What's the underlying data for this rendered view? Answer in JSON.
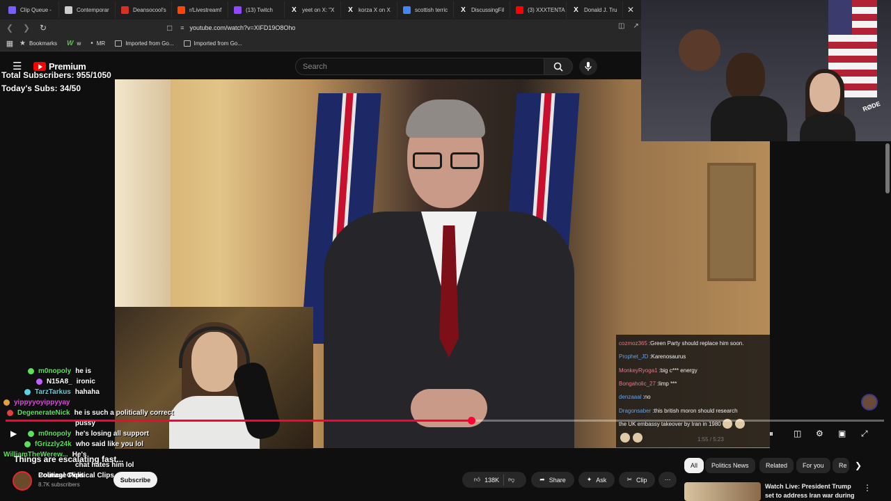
{
  "browser": {
    "tabs": [
      {
        "label": "Clip Queue -",
        "icon_color": "#7b5cff"
      },
      {
        "label": "Contemporar",
        "icon_color": "#cccccc"
      },
      {
        "label": "Deansocool's",
        "icon_color": "#d93025"
      },
      {
        "label": "r/Livestreamf",
        "icon_color": "#ff4500"
      },
      {
        "label": "(13) Twitch",
        "icon_color": "#9146ff"
      },
      {
        "label": "yeet on X: \"X",
        "icon": "x-logo"
      },
      {
        "label": "korza X on X",
        "icon": "x-logo"
      },
      {
        "label": "scottish terric",
        "icon_color": "#4285f4"
      },
      {
        "label": "DiscussingFil",
        "icon": "x-logo"
      },
      {
        "label": "(3) XXXTENTA",
        "icon_color": "#ff0000"
      },
      {
        "label": "Donald J. Tru",
        "icon": "x-logo"
      }
    ],
    "url": "youtube.com/watch?v=XIFD19O8Oho",
    "bookmarks": [
      {
        "label": "Bookmarks",
        "icon": "star-icon"
      },
      {
        "label": "w",
        "icon": "w-logo"
      },
      {
        "label": "MR",
        "icon": "dot-icon"
      },
      {
        "label": "Imported from Go...",
        "icon": "folder-icon"
      },
      {
        "label": "Imported from Go...",
        "icon": "folder-icon"
      }
    ]
  },
  "youtube": {
    "logo_text": "Premium",
    "search_placeholder": "Search"
  },
  "stream_overlay": {
    "total_subs": "Total Subscribers: 955/1050",
    "today_subs": "Today's Subs: 34/50"
  },
  "video_chat": [
    {
      "user": "cozmoz365",
      "user_color": "#e07a8a",
      "message": "Green Party should replace him soon."
    },
    {
      "user": "Prophet_JD",
      "user_color": "#6aa0e0",
      "message": "Karenosaurus"
    },
    {
      "user": "MonkeyRyoga1",
      "user_color": "#e07a8a",
      "message": "big c*** energy"
    },
    {
      "user": "Bongaholic_27",
      "user_color": "#e07a8a",
      "message": "limp ***"
    },
    {
      "user": "denzaaal",
      "user_color": "#6aa0e0",
      "message": "no"
    },
    {
      "user": "Dragonsaber",
      "user_color": "#6aa0e0",
      "message": "this british moron should research"
    },
    {
      "user": "",
      "user_color": "#ffffff",
      "message": "the UK embassy takeover by Iran in 1980"
    }
  ],
  "stream_chat": [
    {
      "user": "m0nopoly",
      "user_color": "#5ce05c",
      "message": "he is"
    },
    {
      "user": "N15A8_",
      "user_color": "#ffffff",
      "message": "ironic"
    },
    {
      "user": "TarzTarkus",
      "user_color": "#5ad0e0",
      "message": "hahaha"
    },
    {
      "user": "yippyyoyippyyay",
      "user_color": "#e04ae0",
      "message": ""
    },
    {
      "user": "DegenerateNick",
      "user_color": "#5ce05c",
      "message": "he is such a politically correct"
    },
    {
      "user": "",
      "user_color": "#ffffff",
      "message": "pussy"
    },
    {
      "user": "m0nopoly",
      "user_color": "#5ce05c",
      "message": "he's losing all support"
    },
    {
      "user": "fGrizzly24k",
      "user_color": "#5ce05c",
      "message": "who said like you lol"
    },
    {
      "user": "WilliamTheWerew...",
      "user_color": "#5ce05c",
      "message": "He's"
    },
    {
      "user": "",
      "user_color": "#ffffff",
      "message": "chat hates him lol"
    },
    {
      "user": "",
      "user_color": "#ffffff",
      "message": "Political Clips"
    }
  ],
  "caption": "Things are escalating fast...",
  "player": {
    "progress": 0.53,
    "timecode": "1:55 / 5:23"
  },
  "channel": {
    "name": "Courage Political Clips",
    "subs": "8.7K subscribers",
    "subscribe_label": "Subscribe"
  },
  "actions": {
    "likes": "138K",
    "share": "Share",
    "ask": "Ask",
    "clip": "Clip"
  },
  "chips": [
    "All",
    "Politics News",
    "Related",
    "For you",
    "Re"
  ],
  "recommendation": {
    "title": "Watch Live: President Trump set to address Iran war during ..."
  }
}
